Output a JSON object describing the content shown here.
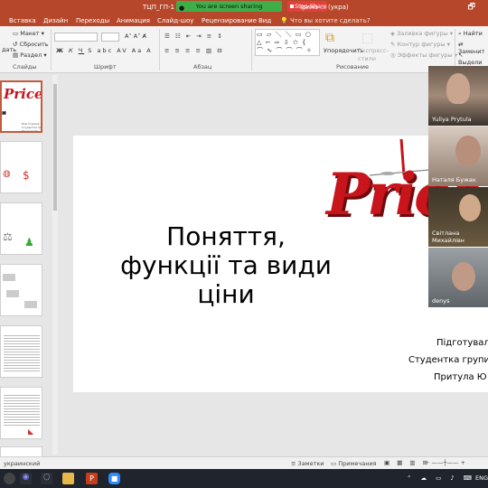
{
  "titlebar": {
    "doc_title_left": "ТЦП_ГП-1",
    "doc_title_right": "Ірина ... (укра)",
    "share_status": "You are screen sharing",
    "stop_share": "Stop Share"
  },
  "ribbon_tabs": [
    "Вставка",
    "Дизайн",
    "Переходы",
    "Анимация",
    "Слайд-шоу",
    "Рецензирование",
    "Вид"
  ],
  "tell_me": "Что вы хотите сделать?",
  "ribbon": {
    "slides": {
      "layout": "Макет",
      "reset": "Сбросить",
      "section": "Раздел",
      "create": "дать",
      "group": "Слайды"
    },
    "font": {
      "group": "Шрифт"
    },
    "paragraph": {
      "group": "Абзац"
    },
    "drawing": {
      "arrange": "Упорядочить",
      "quick_styles": "Экспресс-стили",
      "fill": "Заливка фигуры",
      "outline": "Контур фигуры",
      "effects": "Эффекты фигуры",
      "group": "Рисование"
    },
    "editing": {
      "find": "Найти",
      "replace": "Заменит",
      "select": "Выдели"
    }
  },
  "thumb1": {
    "word": "Price",
    "text": "Підготувала\nСтудентка групи ГП-1\nПритула Ю."
  },
  "slide": {
    "title_l1": "Поняття,",
    "title_l2": "функції та види",
    "title_l3": "ціни",
    "logo": "Price",
    "caption_l1": "Підготувал",
    "caption_l2": "Студентка групи",
    "caption_l3": "Притула Ю"
  },
  "participants": [
    {
      "name": "Yuliya Prytula"
    },
    {
      "name": "Наталя Бужак"
    },
    {
      "name": "Світлана Михайлівн"
    },
    {
      "name": "denys"
    }
  ],
  "status": {
    "language": "украинский",
    "notes": "Заметки",
    "comments": "Примечания"
  },
  "taskbar": {
    "lang": "ENG"
  },
  "colors": {
    "accent": "#b7472a",
    "share_green": "#3fae49",
    "stop_red": "#e0403a",
    "logo_red": "#c8141b"
  }
}
